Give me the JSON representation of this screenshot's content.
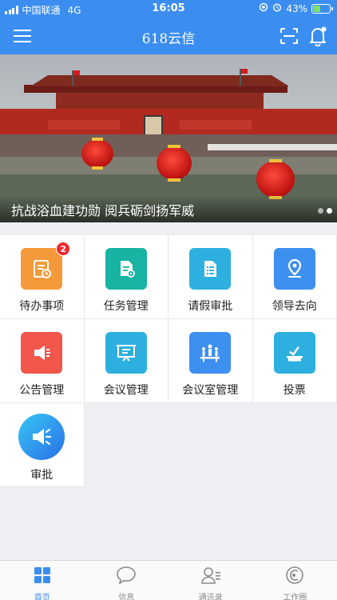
{
  "status_bar": {
    "carrier": "中国联通",
    "network": "4G",
    "time": "16:05",
    "battery": "43%"
  },
  "nav": {
    "title": "618云信",
    "menu_icon": "hamburger-menu-icon",
    "scan_icon": "scan-icon",
    "notify_icon": "bell-icon"
  },
  "banner": {
    "caption": "抗战浴血建功勋  阅兵砺剑扬军威",
    "slides": 2,
    "active_slide": 2
  },
  "menu": {
    "items": [
      {
        "label": "待办事项",
        "icon": "todo-icon",
        "color": "#f59a3a",
        "badge": "2"
      },
      {
        "label": "任务管理",
        "icon": "task-icon",
        "color": "#17b3a3",
        "badge": ""
      },
      {
        "label": "请假审批",
        "icon": "leave-form-icon",
        "color": "#2db0df",
        "badge": ""
      },
      {
        "label": "领导去向",
        "icon": "location-pin-icon",
        "color": "#3d8ff0",
        "badge": ""
      },
      {
        "label": "公告管理",
        "icon": "megaphone-icon",
        "color": "#f0574a",
        "badge": ""
      },
      {
        "label": "会议管理",
        "icon": "meeting-board-icon",
        "color": "#2db0df",
        "badge": ""
      },
      {
        "label": "会议室管理",
        "icon": "meeting-room-icon",
        "color": "#3d8ff0",
        "badge": ""
      },
      {
        "label": "投票",
        "icon": "ballot-box-icon",
        "color": "#2db0df",
        "badge": ""
      },
      {
        "label": "审批",
        "icon": "approval-speaker-icon",
        "color": "#3d8ff0",
        "badge": ""
      }
    ]
  },
  "tabbar": {
    "tabs": [
      {
        "label": "首页",
        "icon": "home-grid-icon",
        "active": true
      },
      {
        "label": "信息",
        "icon": "chat-bubble-icon",
        "active": false
      },
      {
        "label": "通讯录",
        "icon": "contacts-icon",
        "active": false
      },
      {
        "label": "工作圈",
        "icon": "work-circle-icon",
        "active": false
      }
    ]
  }
}
